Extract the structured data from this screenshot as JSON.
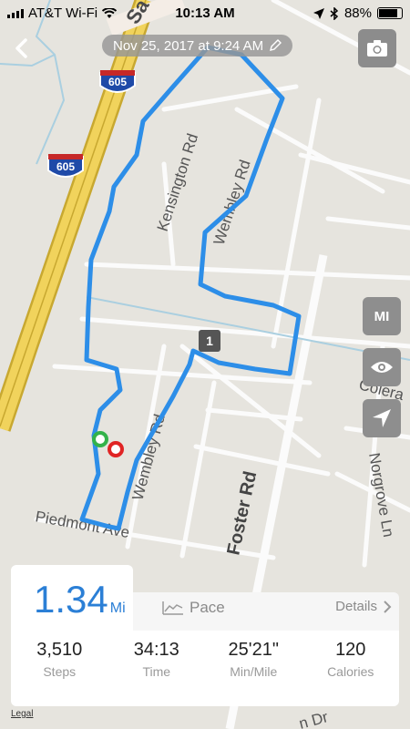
{
  "status_bar": {
    "carrier": "AT&T Wi-Fi",
    "time": "10:13 AM",
    "battery": "88%"
  },
  "header": {
    "date_label": "Nov 25, 2017 at 9:24 AM"
  },
  "map": {
    "highway_shield": "605",
    "streets": [
      "Kensington Rd",
      "Wembley Rd",
      "Wembley Rd",
      "Foster Rd",
      "Piedmont Ave",
      "Norgrove Ln",
      "Colera",
      "Sa",
      "Dr",
      "n Dr"
    ],
    "split_marker": "1",
    "route_color": "#2d8ee8",
    "start_color": "#33b24a",
    "end_color": "#e02424"
  },
  "side_buttons": {
    "units": "MI"
  },
  "summary": {
    "distance": "1.34",
    "unit": "Mi",
    "pace_label": "Pace",
    "details_label": "Details",
    "stats": [
      {
        "value": "3,510",
        "label": "Steps"
      },
      {
        "value": "34:13",
        "label": "Time"
      },
      {
        "value": "25'21\"",
        "label": "Min/Mile"
      },
      {
        "value": "120",
        "label": "Calories"
      }
    ]
  },
  "legal": "Legal",
  "icons": [
    "back-icon",
    "pencil-icon",
    "camera-icon",
    "eye-icon",
    "location-arrow-icon",
    "pace-chart-icon",
    "chevron-right-icon",
    "wifi-icon",
    "bluetooth-icon"
  ]
}
